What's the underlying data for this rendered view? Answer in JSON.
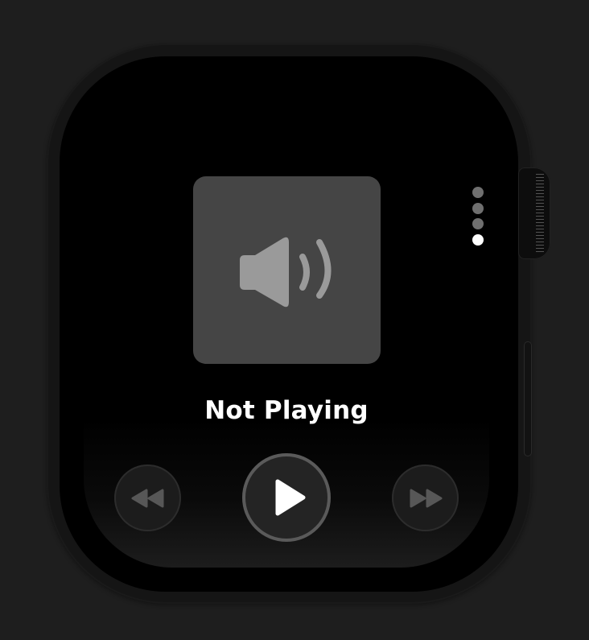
{
  "now_playing": {
    "title": "Not Playing",
    "artwork_icon": "speaker-volume-icon"
  },
  "page_indicator": {
    "count": 4,
    "active_index": 3
  },
  "controls": {
    "rewind_icon": "rewind-icon",
    "play_icon": "play-icon",
    "forward_icon": "fast-forward-icon"
  },
  "colors": {
    "background": "#1e1e1e",
    "screen": "#000000",
    "artwork_bg": "#454545",
    "icon_gray": "#9a9a9a",
    "dot_inactive": "#6f6f6f",
    "dot_active": "#ffffff"
  }
}
